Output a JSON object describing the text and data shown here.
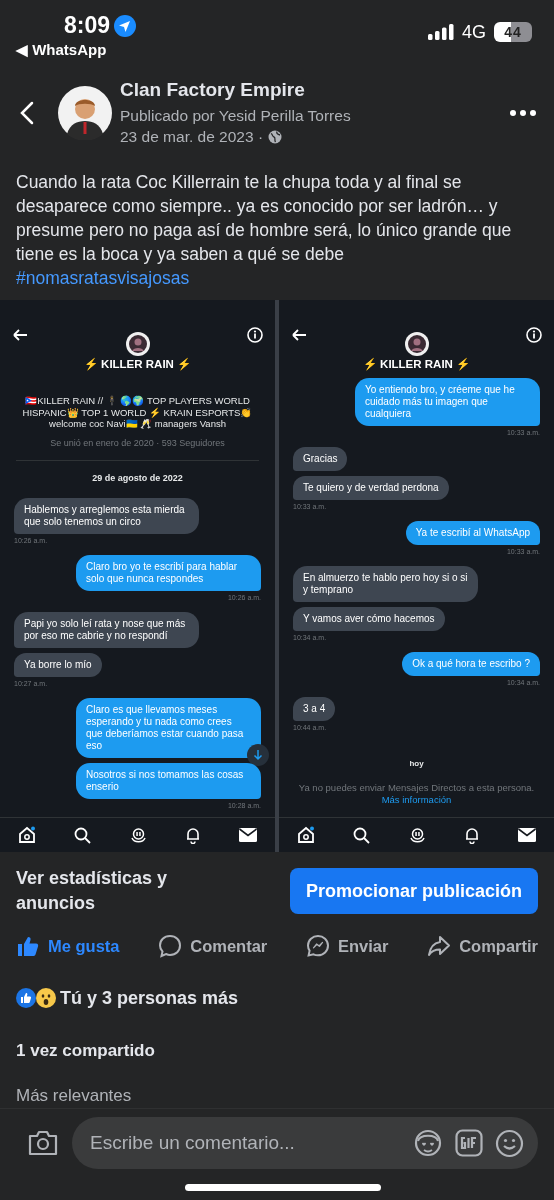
{
  "status_bar": {
    "time": "8:09",
    "back_app": "◀ WhatsApp",
    "network": "4G",
    "battery": "44"
  },
  "post": {
    "page_name": "Clan Factory Empire",
    "byline": "Publicado por Yesid Perilla Torres",
    "date": "23 de mar. de 2023 ·",
    "text": "Cuando la rata Coc Killerrain te la chupa toda y al final se desaparece como siempre.. ya es conocido por ser ladrón… y presume pero no paga así de hombre será, lo único grande que tiene es la boca y ya saben a qué se debe",
    "hashtag": "#nomasratasvisajosas"
  },
  "image": {
    "panels": [
      {
        "title": "⚡ KILLER RAIN ⚡",
        "bio": "🇵🇷KILLER RAIN // 🕴 🌎🌍 TOP PLAYERS WORLD HISPANIC👑 TOP 1 WORLD ⚡ KRAIN ESPORTS👏 welcome coc Navi🇺🇦 🥂 managers Vansh",
        "joined": "Se unió en enero de 2020 · 593 Seguidores",
        "date_divider": "29 de agosto de 2022",
        "messages": [
          {
            "kind": "received",
            "text": "Hablemos y arreglemos esta mierda que solo tenemos un circo",
            "time": "10:26 a.m."
          },
          {
            "kind": "sent",
            "text": "Claro bro yo te escribí para hablar solo que nunca respondes",
            "time": "10:26 a.m."
          },
          {
            "kind": "received",
            "text": "Papi yo solo leí rata y nose que más por eso me cabrie y no respondí"
          },
          {
            "kind": "received",
            "text": "Ya borre lo mío",
            "time": "10:27 a.m."
          },
          {
            "kind": "sent",
            "text": "Claro es que llevamos meses esperando y tu nada como crees que deberíamos estar cuando pasa eso",
            "scroll_button": true
          },
          {
            "kind": "sent",
            "text": "Nosotros si nos tomamos las cosas enserio",
            "time": "10:28 a.m."
          }
        ]
      },
      {
        "title": "⚡ KILLER RAIN ⚡",
        "messages": [
          {
            "kind": "sent",
            "text": "Yo entiendo bro, y créeme que he cuidado más tu imagen que cualquiera",
            "time": "10:33 a.m."
          },
          {
            "kind": "received",
            "text": "Gracias"
          },
          {
            "kind": "received",
            "text": "Te quiero y de verdad perdona",
            "time": "10:33 a.m."
          },
          {
            "kind": "sent",
            "text": "Ya te escribí al WhatsApp",
            "time": "10:33 a.m."
          },
          {
            "kind": "received",
            "text": "En almuerzo te hablo pero hoy si o si y temprano"
          },
          {
            "kind": "received",
            "text": "Y vamos aver cómo hacemos",
            "time": "10:34 a.m."
          },
          {
            "kind": "sent",
            "text": "Ok a qué hora te escribo ?",
            "time": "10:34 a.m."
          },
          {
            "kind": "received",
            "text": "3 a 4",
            "time": "10:44 a.m."
          }
        ],
        "day_divider": "hoy",
        "notice": "Ya no puedes enviar Mensajes Directos a esta persona.",
        "notice_link": "Más información"
      }
    ]
  },
  "insights": "Ver estadísticas y anuncios",
  "promote_button": "Promocionar publicación",
  "actions": [
    {
      "kind": "like",
      "label": "Me gusta",
      "selected": true
    },
    {
      "kind": "comment",
      "label": "Comentar",
      "selected": false
    },
    {
      "kind": "send",
      "label": "Enviar",
      "selected": false
    },
    {
      "kind": "share",
      "label": "Compartir",
      "selected": false
    }
  ],
  "reactions": "Tú y 3 personas más",
  "shares": "1 vez compartido",
  "sort": "Más relevantes",
  "comment_field": {
    "placeholder": "Escribe un comentario..."
  }
}
